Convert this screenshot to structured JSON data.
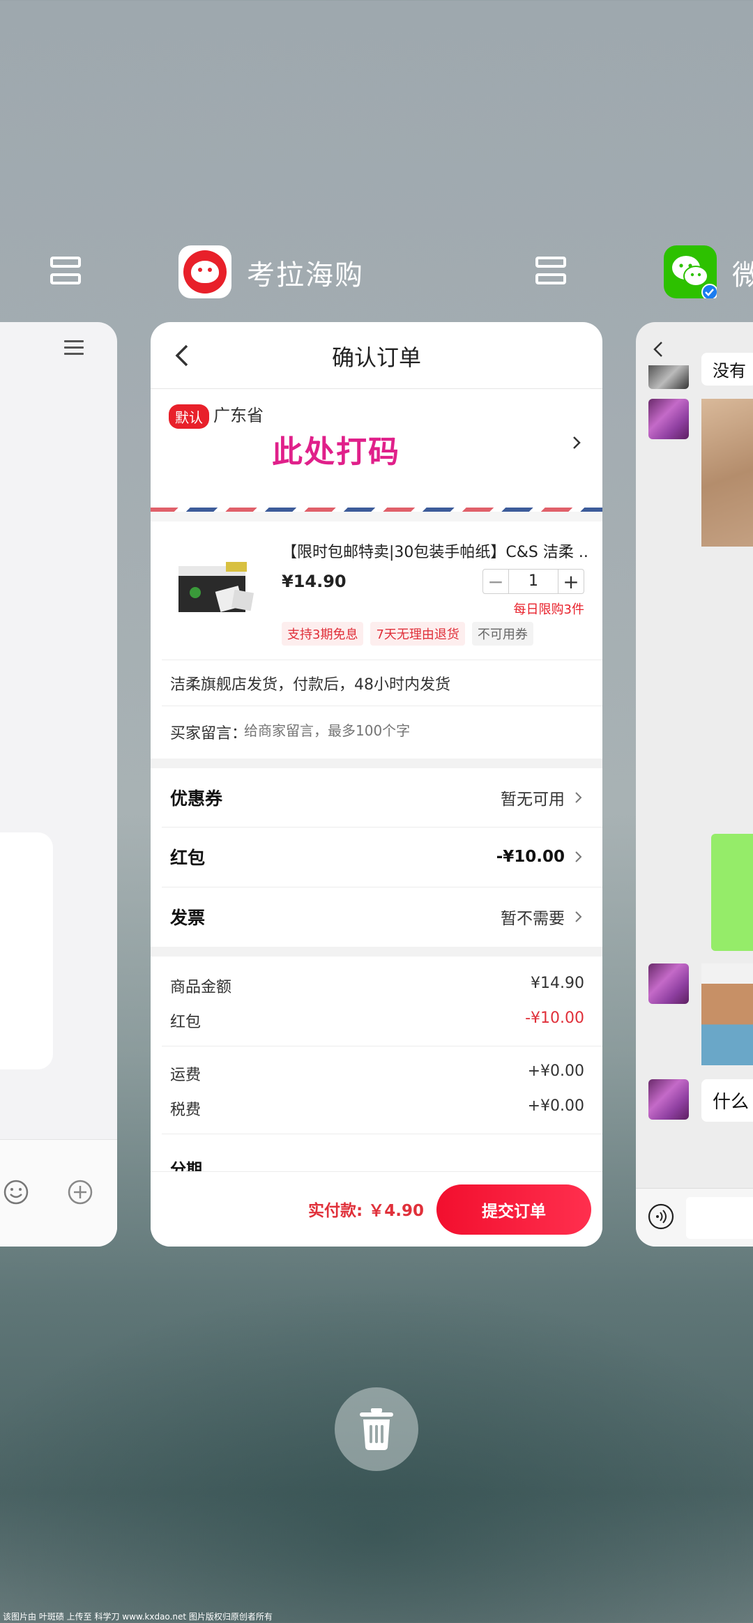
{
  "headers": {
    "kaola_title": "考拉海购",
    "wechat_title": "微"
  },
  "order": {
    "nav_title": "确认订单",
    "address": {
      "default_badge": "默认",
      "province": "广东省",
      "redacted_text": "此处打码"
    },
    "product": {
      "name": "【限时包邮特卖|30包装手帕纸】C&S 洁柔 ...",
      "price": "¥14.90",
      "quantity": "1",
      "limit": "每日限购3件",
      "tags": [
        "支持3期免息",
        "7天无理由退货",
        "不可用券"
      ]
    },
    "shipping_note": "洁柔旗舰店发货，付款后，48小时内发货",
    "message": {
      "label": "买家留言：",
      "placeholder": "给商家留言，最多100个字"
    },
    "options": {
      "coupon_label": "优惠券",
      "coupon_value": "暂无可用",
      "redpacket_label": "红包",
      "redpacket_value": "-¥10.00",
      "invoice_label": "发票",
      "invoice_value": "暂不需要"
    },
    "summary": {
      "goods_label": "商品金额",
      "goods_value": "¥14.90",
      "redpacket_label": "红包",
      "redpacket_value": "-¥10.00",
      "freight_label": "运费",
      "freight_value": "+¥0.00",
      "tax_label": "税费",
      "tax_value": "+¥0.00",
      "installment_label": "分期"
    },
    "footer": {
      "pay_label": "实付款: ￥4.90",
      "submit_label": "提交订单"
    }
  },
  "right_card": {
    "msg_top": "没有",
    "msg_bottom": "什么"
  },
  "watermark": "该图片由 叶斑碛 上传至 科学刀 www.kxdao.net 图片版权归原创者所有",
  "colors": {
    "brand_red": "#e8202a",
    "code_magenta": "#e0208a",
    "wechat_green": "#2dc100"
  },
  "icons": [
    "split-screen-icon",
    "kaola-app-icon",
    "wechat-app-icon",
    "back-arrow-icon",
    "chevron-right-icon",
    "menu-icon",
    "smile-icon",
    "plus-circle-icon",
    "voice-icon",
    "trash-icon"
  ]
}
